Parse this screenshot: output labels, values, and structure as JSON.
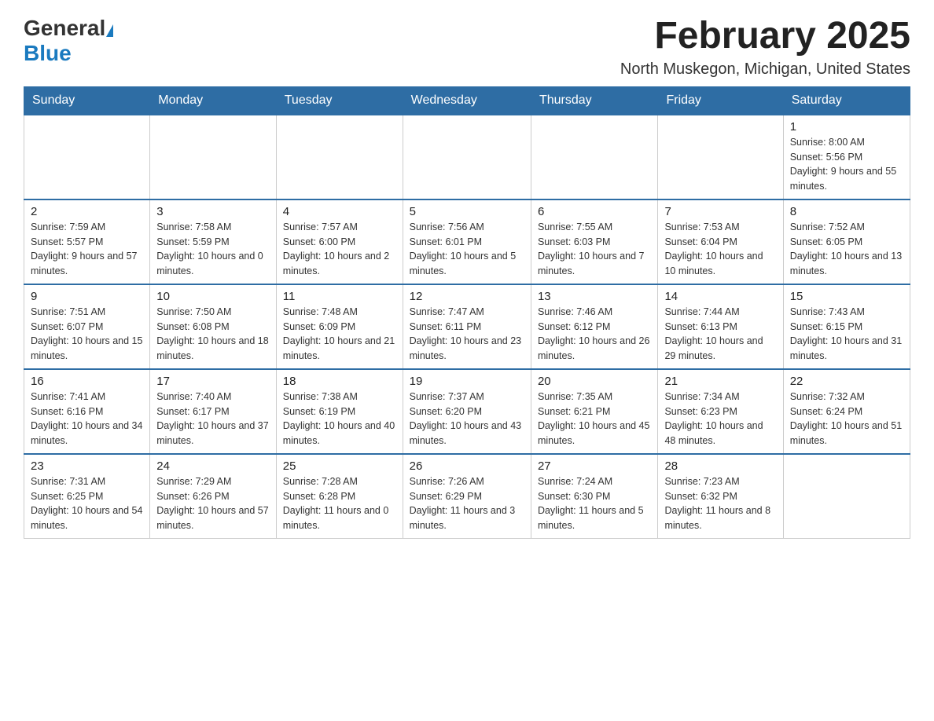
{
  "header": {
    "logo_general": "General",
    "logo_blue": "Blue",
    "month_title": "February 2025",
    "location": "North Muskegon, Michigan, United States"
  },
  "days_of_week": [
    "Sunday",
    "Monday",
    "Tuesday",
    "Wednesday",
    "Thursday",
    "Friday",
    "Saturday"
  ],
  "weeks": [
    [
      {
        "day": "",
        "sunrise": "",
        "sunset": "",
        "daylight": "",
        "empty": true
      },
      {
        "day": "",
        "sunrise": "",
        "sunset": "",
        "daylight": "",
        "empty": true
      },
      {
        "day": "",
        "sunrise": "",
        "sunset": "",
        "daylight": "",
        "empty": true
      },
      {
        "day": "",
        "sunrise": "",
        "sunset": "",
        "daylight": "",
        "empty": true
      },
      {
        "day": "",
        "sunrise": "",
        "sunset": "",
        "daylight": "",
        "empty": true
      },
      {
        "day": "",
        "sunrise": "",
        "sunset": "",
        "daylight": "",
        "empty": true
      },
      {
        "day": "1",
        "sunrise": "Sunrise: 8:00 AM",
        "sunset": "Sunset: 5:56 PM",
        "daylight": "Daylight: 9 hours and 55 minutes.",
        "empty": false
      }
    ],
    [
      {
        "day": "2",
        "sunrise": "Sunrise: 7:59 AM",
        "sunset": "Sunset: 5:57 PM",
        "daylight": "Daylight: 9 hours and 57 minutes.",
        "empty": false
      },
      {
        "day": "3",
        "sunrise": "Sunrise: 7:58 AM",
        "sunset": "Sunset: 5:59 PM",
        "daylight": "Daylight: 10 hours and 0 minutes.",
        "empty": false
      },
      {
        "day": "4",
        "sunrise": "Sunrise: 7:57 AM",
        "sunset": "Sunset: 6:00 PM",
        "daylight": "Daylight: 10 hours and 2 minutes.",
        "empty": false
      },
      {
        "day": "5",
        "sunrise": "Sunrise: 7:56 AM",
        "sunset": "Sunset: 6:01 PM",
        "daylight": "Daylight: 10 hours and 5 minutes.",
        "empty": false
      },
      {
        "day": "6",
        "sunrise": "Sunrise: 7:55 AM",
        "sunset": "Sunset: 6:03 PM",
        "daylight": "Daylight: 10 hours and 7 minutes.",
        "empty": false
      },
      {
        "day": "7",
        "sunrise": "Sunrise: 7:53 AM",
        "sunset": "Sunset: 6:04 PM",
        "daylight": "Daylight: 10 hours and 10 minutes.",
        "empty": false
      },
      {
        "day": "8",
        "sunrise": "Sunrise: 7:52 AM",
        "sunset": "Sunset: 6:05 PM",
        "daylight": "Daylight: 10 hours and 13 minutes.",
        "empty": false
      }
    ],
    [
      {
        "day": "9",
        "sunrise": "Sunrise: 7:51 AM",
        "sunset": "Sunset: 6:07 PM",
        "daylight": "Daylight: 10 hours and 15 minutes.",
        "empty": false
      },
      {
        "day": "10",
        "sunrise": "Sunrise: 7:50 AM",
        "sunset": "Sunset: 6:08 PM",
        "daylight": "Daylight: 10 hours and 18 minutes.",
        "empty": false
      },
      {
        "day": "11",
        "sunrise": "Sunrise: 7:48 AM",
        "sunset": "Sunset: 6:09 PM",
        "daylight": "Daylight: 10 hours and 21 minutes.",
        "empty": false
      },
      {
        "day": "12",
        "sunrise": "Sunrise: 7:47 AM",
        "sunset": "Sunset: 6:11 PM",
        "daylight": "Daylight: 10 hours and 23 minutes.",
        "empty": false
      },
      {
        "day": "13",
        "sunrise": "Sunrise: 7:46 AM",
        "sunset": "Sunset: 6:12 PM",
        "daylight": "Daylight: 10 hours and 26 minutes.",
        "empty": false
      },
      {
        "day": "14",
        "sunrise": "Sunrise: 7:44 AM",
        "sunset": "Sunset: 6:13 PM",
        "daylight": "Daylight: 10 hours and 29 minutes.",
        "empty": false
      },
      {
        "day": "15",
        "sunrise": "Sunrise: 7:43 AM",
        "sunset": "Sunset: 6:15 PM",
        "daylight": "Daylight: 10 hours and 31 minutes.",
        "empty": false
      }
    ],
    [
      {
        "day": "16",
        "sunrise": "Sunrise: 7:41 AM",
        "sunset": "Sunset: 6:16 PM",
        "daylight": "Daylight: 10 hours and 34 minutes.",
        "empty": false
      },
      {
        "day": "17",
        "sunrise": "Sunrise: 7:40 AM",
        "sunset": "Sunset: 6:17 PM",
        "daylight": "Daylight: 10 hours and 37 minutes.",
        "empty": false
      },
      {
        "day": "18",
        "sunrise": "Sunrise: 7:38 AM",
        "sunset": "Sunset: 6:19 PM",
        "daylight": "Daylight: 10 hours and 40 minutes.",
        "empty": false
      },
      {
        "day": "19",
        "sunrise": "Sunrise: 7:37 AM",
        "sunset": "Sunset: 6:20 PM",
        "daylight": "Daylight: 10 hours and 43 minutes.",
        "empty": false
      },
      {
        "day": "20",
        "sunrise": "Sunrise: 7:35 AM",
        "sunset": "Sunset: 6:21 PM",
        "daylight": "Daylight: 10 hours and 45 minutes.",
        "empty": false
      },
      {
        "day": "21",
        "sunrise": "Sunrise: 7:34 AM",
        "sunset": "Sunset: 6:23 PM",
        "daylight": "Daylight: 10 hours and 48 minutes.",
        "empty": false
      },
      {
        "day": "22",
        "sunrise": "Sunrise: 7:32 AM",
        "sunset": "Sunset: 6:24 PM",
        "daylight": "Daylight: 10 hours and 51 minutes.",
        "empty": false
      }
    ],
    [
      {
        "day": "23",
        "sunrise": "Sunrise: 7:31 AM",
        "sunset": "Sunset: 6:25 PM",
        "daylight": "Daylight: 10 hours and 54 minutes.",
        "empty": false
      },
      {
        "day": "24",
        "sunrise": "Sunrise: 7:29 AM",
        "sunset": "Sunset: 6:26 PM",
        "daylight": "Daylight: 10 hours and 57 minutes.",
        "empty": false
      },
      {
        "day": "25",
        "sunrise": "Sunrise: 7:28 AM",
        "sunset": "Sunset: 6:28 PM",
        "daylight": "Daylight: 11 hours and 0 minutes.",
        "empty": false
      },
      {
        "day": "26",
        "sunrise": "Sunrise: 7:26 AM",
        "sunset": "Sunset: 6:29 PM",
        "daylight": "Daylight: 11 hours and 3 minutes.",
        "empty": false
      },
      {
        "day": "27",
        "sunrise": "Sunrise: 7:24 AM",
        "sunset": "Sunset: 6:30 PM",
        "daylight": "Daylight: 11 hours and 5 minutes.",
        "empty": false
      },
      {
        "day": "28",
        "sunrise": "Sunrise: 7:23 AM",
        "sunset": "Sunset: 6:32 PM",
        "daylight": "Daylight: 11 hours and 8 minutes.",
        "empty": false
      },
      {
        "day": "",
        "sunrise": "",
        "sunset": "",
        "daylight": "",
        "empty": true
      }
    ]
  ]
}
